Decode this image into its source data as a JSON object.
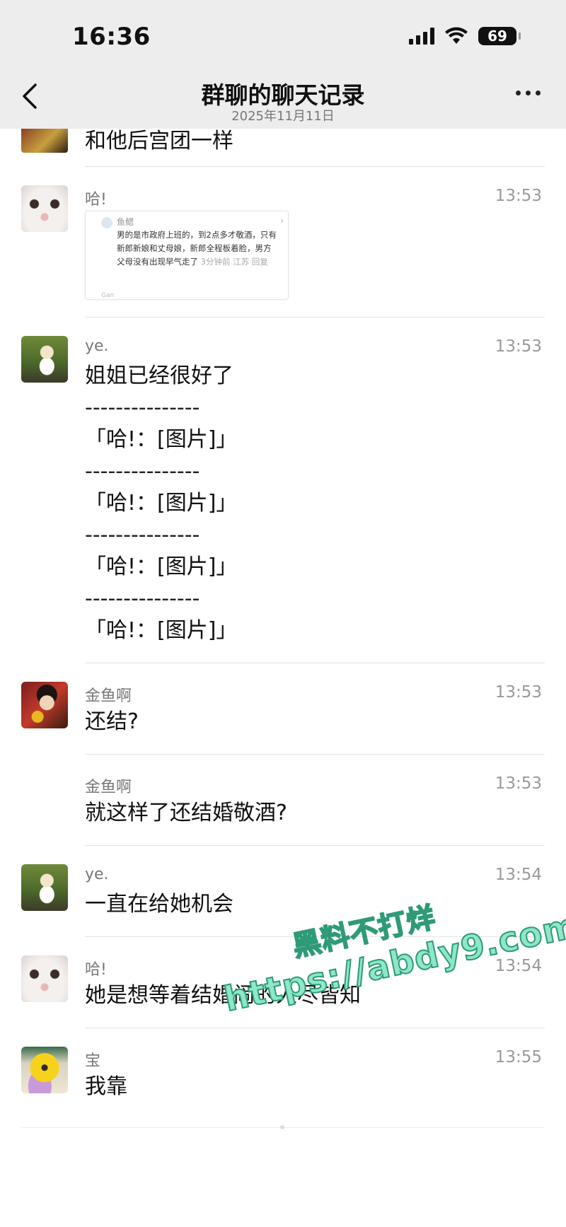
{
  "status_bar": {
    "time": "16:36",
    "battery": "69"
  },
  "header": {
    "title": "群聊的聊天记录",
    "subtitle": "2025年11月11日"
  },
  "partial_message": {
    "text": "和他后宫团一样"
  },
  "quote_card": {
    "name": "鱼鳃",
    "body": "男的是市政府上班的，到2点多才敬酒，只有新郎新娘和丈母娘，新郎全程板着脸，男方父母没有出现早气走了",
    "meta": "3分钟前 江苏 回复",
    "bottom_name": "Gan"
  },
  "messages": [
    {
      "sender": "哈!",
      "time": "13:53",
      "text": "",
      "avatar": "cat"
    },
    {
      "sender": "ye.",
      "time": "13:53",
      "avatar": "girl",
      "lines": [
        "姐姐已经很好了",
        "---------------",
        "「哈!：[图片]」",
        "---------------",
        "「哈!：[图片]」",
        "---------------",
        "「哈!：[图片]」",
        "---------------",
        "「哈!：[图片]」"
      ]
    },
    {
      "sender": "金鱼啊",
      "time": "13:53",
      "text": "还结?",
      "avatar": "goldfish"
    },
    {
      "sender": "金鱼啊",
      "time": "13:53",
      "text": "就这样了还结婚敬酒?",
      "avatar": ""
    },
    {
      "sender": "ye.",
      "time": "13:54",
      "text": "一直在给她机会",
      "avatar": "girl"
    },
    {
      "sender": "哈!",
      "time": "13:54",
      "text": "她是想等着结婚闹的人尽皆知",
      "avatar": "cat"
    },
    {
      "sender": "宝",
      "time": "13:55",
      "text": "我靠",
      "avatar": "bao"
    }
  ],
  "watermark": {
    "line1": "黑料不打烊",
    "line2": "https://abdy9.com"
  }
}
